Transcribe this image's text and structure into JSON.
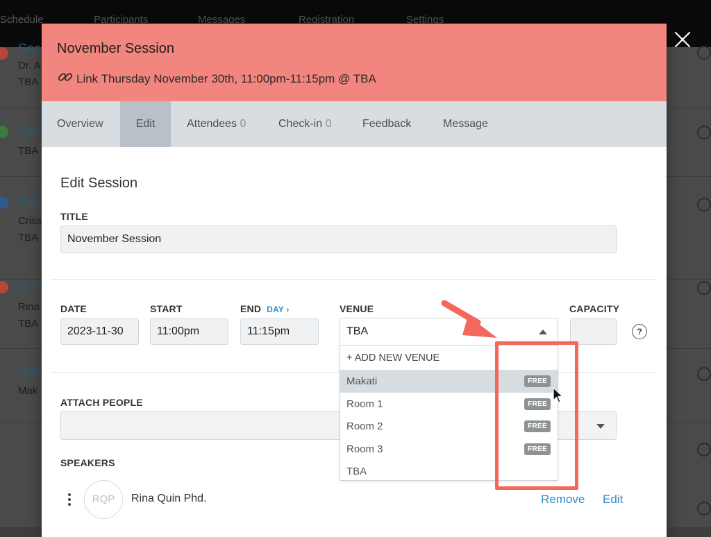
{
  "background": {
    "nav": [
      "Schedule",
      "Participants",
      "Messages",
      "Registration",
      "Settings"
    ],
    "rows": [
      {
        "title": "Ses",
        "lines": [
          "Dr. A",
          "TBA"
        ],
        "dot": "#b2473c"
      },
      {
        "title": "Ses",
        "lines": [
          "TBA"
        ],
        "dot": "#3a7a3a"
      },
      {
        "title": "Ses",
        "lines": [
          "Criss",
          "TBA"
        ],
        "dot": "#2d5c8a"
      },
      {
        "title": "Nov",
        "lines": [
          "Rina",
          "TBA"
        ],
        "dot": "#b2473c"
      },
      {
        "title": "Add",
        "lines": [
          "Mak"
        ],
        "dot": ""
      }
    ]
  },
  "modal": {
    "title": "November Session",
    "link_label": "Link",
    "datetime": "Thursday November 30th, 11:00pm-11:15pm @ TBA",
    "tabs": [
      {
        "label": "Overview",
        "count": ""
      },
      {
        "label": "Edit",
        "count": ""
      },
      {
        "label": "Attendees",
        "count": "0"
      },
      {
        "label": "Check-in",
        "count": "0"
      },
      {
        "label": "Feedback",
        "count": ""
      },
      {
        "label": "Message",
        "count": ""
      }
    ],
    "active_tab": "Edit"
  },
  "form": {
    "section_title": "Edit Session",
    "title_label": "TITLE",
    "title_value": "November Session",
    "date_label": "DATE",
    "date_value": "2023-11-30",
    "start_label": "START",
    "start_value": "11:00pm",
    "end_label": "END",
    "day_link": "DAY ›",
    "end_value": "11:15pm",
    "venue_label": "VENUE",
    "venue_value": "TBA",
    "capacity_label": "CAPACITY",
    "capacity_value": "",
    "help": "?",
    "attach_label": "ATTACH PEOPLE",
    "speakers_label": "SPEAKERS"
  },
  "venue_dropdown": {
    "add_new": "+ ADD NEW VENUE",
    "options": [
      {
        "label": "Makati",
        "badge": "FREE"
      },
      {
        "label": "Room 1",
        "badge": "FREE"
      },
      {
        "label": "Room 2",
        "badge": "FREE"
      },
      {
        "label": "Room 3",
        "badge": "FREE"
      },
      {
        "label": "TBA",
        "badge": ""
      }
    ],
    "highlighted": "Makati"
  },
  "speaker": {
    "initials": "RQP",
    "name": "Rina Quin Phd.",
    "remove": "Remove",
    "edit": "Edit"
  },
  "colors": {
    "header": "#f2857d",
    "tabs_bg": "#d8dde1",
    "tab_active": "#b9c0c7",
    "link": "#2f8fc7",
    "annotation": "#f2685b",
    "badge": "#8e9294"
  }
}
